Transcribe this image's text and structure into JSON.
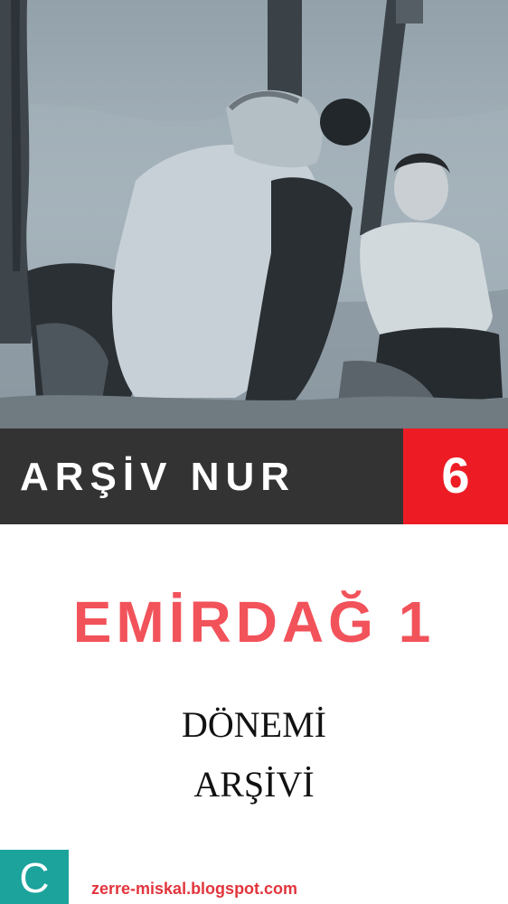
{
  "banner": {
    "title": "ARŞİV NUR",
    "number": "6"
  },
  "heading": "EMİRDAĞ 1",
  "subtitle": {
    "line1": "DÖNEMİ",
    "line2": "ARŞİVİ"
  },
  "badge": {
    "letter": "C"
  },
  "footer": {
    "website": "zerre-miskal.blogspot.com"
  },
  "photo": {
    "description_icon": "archive-photo"
  },
  "colors": {
    "banner_dark": "#333333",
    "banner_red": "#ed1c24",
    "heading_red": "#f2525a",
    "badge_teal": "#1ba39c",
    "site_red": "#e2353d"
  }
}
